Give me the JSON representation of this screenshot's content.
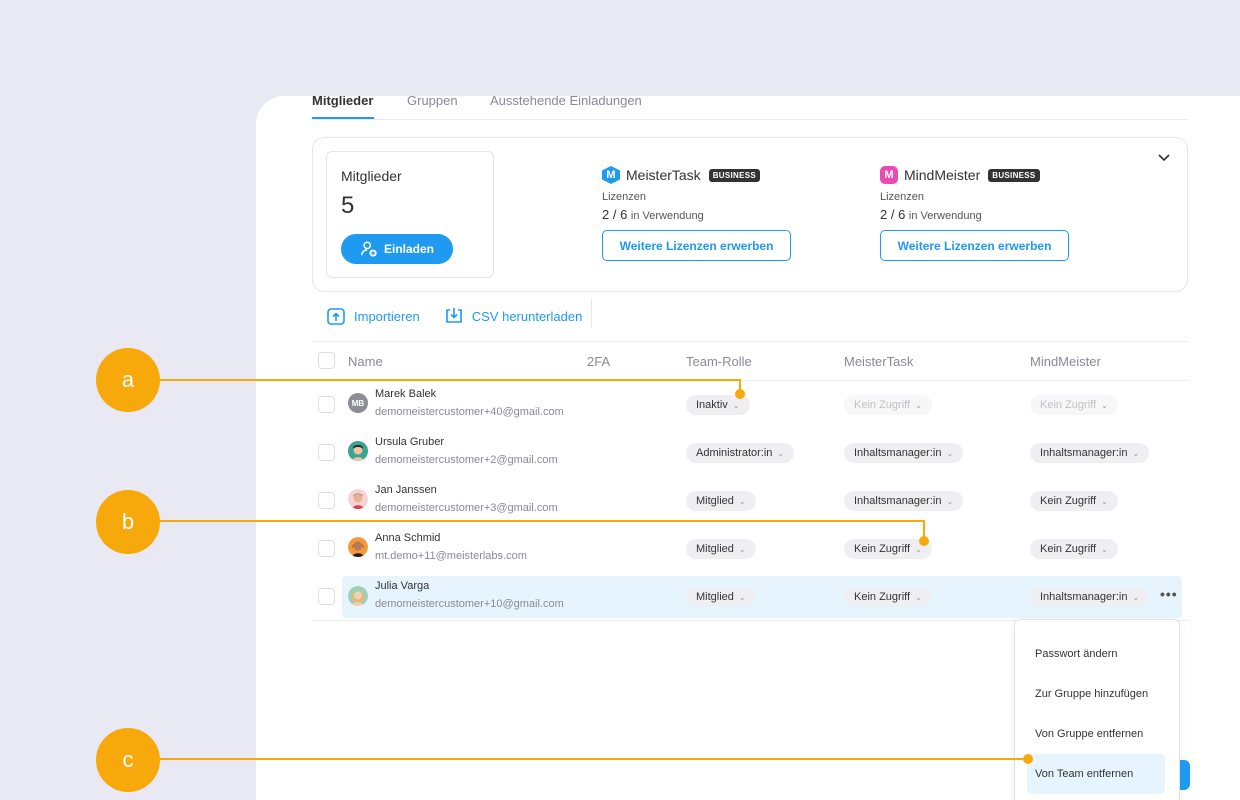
{
  "tabs": [
    {
      "label": "Mitglieder",
      "active": true
    },
    {
      "label": "Gruppen",
      "active": false
    },
    {
      "label": "Ausstehende Einladungen",
      "active": false
    }
  ],
  "summary": {
    "members_label": "Mitglieder",
    "members_count": "5",
    "invite_label": "Einladen"
  },
  "products": [
    {
      "name": "MeisterTask",
      "badge": "BUSINESS",
      "licenses_label": "Lizenzen",
      "used": "2 / 6",
      "used_suffix": "in Verwendung",
      "button": "Weitere Lizenzen erwerben",
      "logo_letter": "M",
      "color": "#1e9af0"
    },
    {
      "name": "MindMeister",
      "badge": "BUSINESS",
      "licenses_label": "Lizenzen",
      "used": "2 / 6",
      "used_suffix": "in Verwendung",
      "button": "Weitere Lizenzen erwerben",
      "logo_letter": "M",
      "color": "#e94cb0"
    }
  ],
  "actions": {
    "import": "Importieren",
    "csv": "CSV herunterladen"
  },
  "table": {
    "columns": [
      "Name",
      "2FA",
      "Team-Rolle",
      "MeisterTask",
      "MindMeister"
    ],
    "rows": [
      {
        "name": "Marek Balek",
        "email": "demomeistercustomer+40@gmail.com",
        "initials": "MB",
        "role": "Inaktiv",
        "meistertask": "Kein Zugriff",
        "mindmeister": "Kein Zugriff",
        "muted": true
      },
      {
        "name": "Ursula Gruber",
        "email": "demomeistercustomer+2@gmail.com",
        "role": "Administrator:in",
        "meistertask": "Inhaltsmanager:in",
        "mindmeister": "Inhaltsmanager:in"
      },
      {
        "name": "Jan Janssen",
        "email": "demomeistercustomer+3@gmail.com",
        "role": "Mitglied",
        "meistertask": "Inhaltsmanager:in",
        "mindmeister": "Kein Zugriff"
      },
      {
        "name": "Anna Schmid",
        "email": "mt.demo+11@meisterlabs.com",
        "role": "Mitglied",
        "meistertask": "Kein Zugriff",
        "mindmeister": "Kein Zugriff"
      },
      {
        "name": "Julia Varga",
        "email": "demomeistercustomer+10@gmail.com",
        "role": "Mitglied",
        "meistertask": "Kein Zugriff",
        "mindmeister": "Inhaltsmanager:in",
        "highlighted": true
      }
    ]
  },
  "context_menu": [
    {
      "label": "Passwort ändern"
    },
    {
      "label": "Zur Gruppe hinzufügen"
    },
    {
      "label": "Von Gruppe entfernen"
    },
    {
      "label": "Von Team entfernen",
      "active": true
    }
  ],
  "callouts": [
    "a",
    "b",
    "c"
  ],
  "colors": {
    "accent": "#1e9af0",
    "callout": "#f7a90b",
    "background": "#e9e9f3"
  },
  "icons": {
    "dropdown": "chevron-down-icon",
    "more": "more-horizontal-icon",
    "import": "upload-icon",
    "csv": "download-icon",
    "invite": "add-user-icon"
  }
}
